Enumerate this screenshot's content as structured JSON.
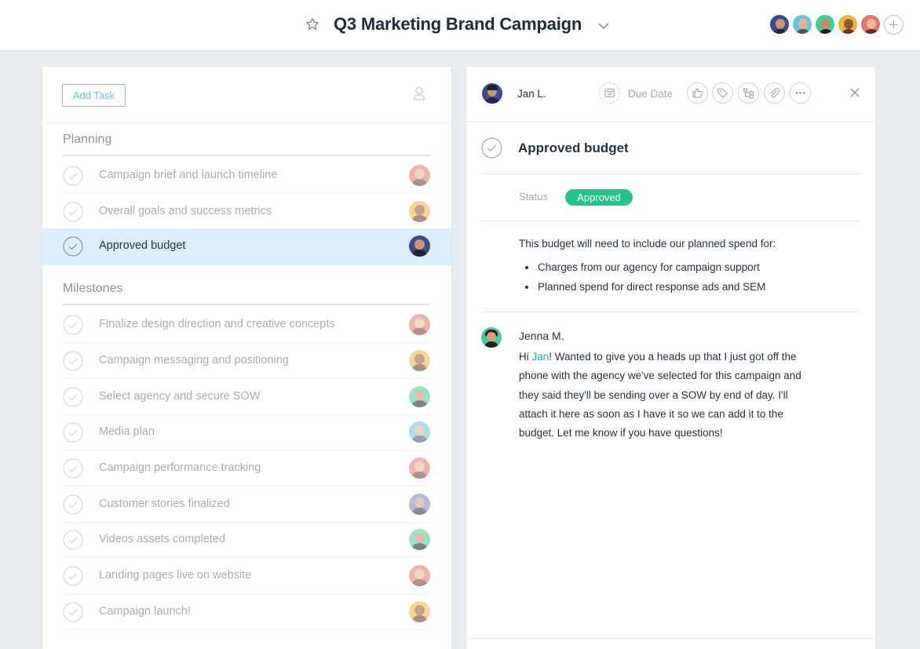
{
  "header": {
    "project_title": "Q3 Marketing Brand Campaign",
    "members": [
      {
        "name": "member-1",
        "bg": "#3e4a8a",
        "skin": "#c89574",
        "shirt": "#1d2240"
      },
      {
        "name": "member-2",
        "bg": "#62c6e4",
        "skin": "#e4b28c",
        "shirt": "#4a5663"
      },
      {
        "name": "member-3",
        "bg": "#3fcf9d",
        "skin": "#c98a64",
        "shirt": "#1f1f24"
      },
      {
        "name": "member-4",
        "bg": "#f2b33d",
        "skin": "#8d5a3c",
        "shirt": "#6b2f2a"
      },
      {
        "name": "member-5",
        "bg": "#e2756c",
        "skin": "#e9b896",
        "shirt": "#5a2f2a"
      }
    ]
  },
  "left_panel": {
    "add_task_label": "Add Task",
    "sections": [
      {
        "title": "Planning",
        "tasks": [
          {
            "name": "Campaign brief and launch timeline",
            "avatar": "red",
            "selected": false
          },
          {
            "name": "Overall goals and success metrics",
            "avatar": "yellow",
            "selected": false
          },
          {
            "name": "Approved budget",
            "avatar": "navy",
            "selected": true
          }
        ]
      },
      {
        "title": "Milestones",
        "tasks": [
          {
            "name": "Finalize design direction and creative concepts",
            "avatar": "red",
            "selected": false
          },
          {
            "name": "Campaign messaging and positioning",
            "avatar": "yellow",
            "selected": false
          },
          {
            "name": "Select agency and secure SOW",
            "avatar": "green",
            "selected": false
          },
          {
            "name": "Media plan",
            "avatar": "blue",
            "selected": false
          },
          {
            "name": "Campaign performance tracking",
            "avatar": "red",
            "selected": false
          },
          {
            "name": "Customer stories finalized",
            "avatar": "purple",
            "selected": false
          },
          {
            "name": "Videos assets completed",
            "avatar": "green",
            "selected": false
          },
          {
            "name": "Landing pages live on website",
            "avatar": "red",
            "selected": false
          },
          {
            "name": "Campaign launch!",
            "avatar": "yellow",
            "selected": false
          }
        ]
      }
    ]
  },
  "avatar_colors": {
    "red": {
      "bg": "#e2756c",
      "skin": "#e9b896",
      "shirt": "#6a3b36"
    },
    "yellow": {
      "bg": "#f2b33d",
      "skin": "#8d5a3c",
      "shirt": "#6b2f2a"
    },
    "navy": {
      "bg": "#3e4a8a",
      "skin": "#c89574",
      "shirt": "#1d2240"
    },
    "green": {
      "bg": "#3fcf9d",
      "skin": "#c98a64",
      "shirt": "#1f1f24"
    },
    "blue": {
      "bg": "#62c6e4",
      "skin": "#e4b28c",
      "shirt": "#4a5663"
    },
    "purple": {
      "bg": "#7a7fb8",
      "skin": "#c8a084",
      "shirt": "#2b2e4a"
    }
  },
  "detail": {
    "assignee_name": "Jan L.",
    "due_date_label": "Due Date",
    "task_title": "Approved budget",
    "status_label": "Status",
    "status_value": "Approved",
    "status_color": "#25c28a",
    "description": "This budget will need to include our planned spend for:",
    "bullets": [
      "Charges from our agency for campaign support",
      "Planned spend for direct response ads and SEM"
    ],
    "comment": {
      "author": "Jenna M.",
      "greeting": "Hi ",
      "mention": "Jan",
      "text": "! Wanted to give you a heads up that I just got off the phone with the agency we've selected for this campaign and they said they'll be sending over a SOW by end of day. I'll attach it here as soon as I have it so we can add it to the budget. Let me know if you have questions!"
    },
    "actions": [
      "like-icon",
      "tag-icon",
      "subtask-icon",
      "attachment-icon",
      "more-icon"
    ]
  },
  "accent_color": "#5cc8e4",
  "selected_row_color": "#dbf0fb"
}
